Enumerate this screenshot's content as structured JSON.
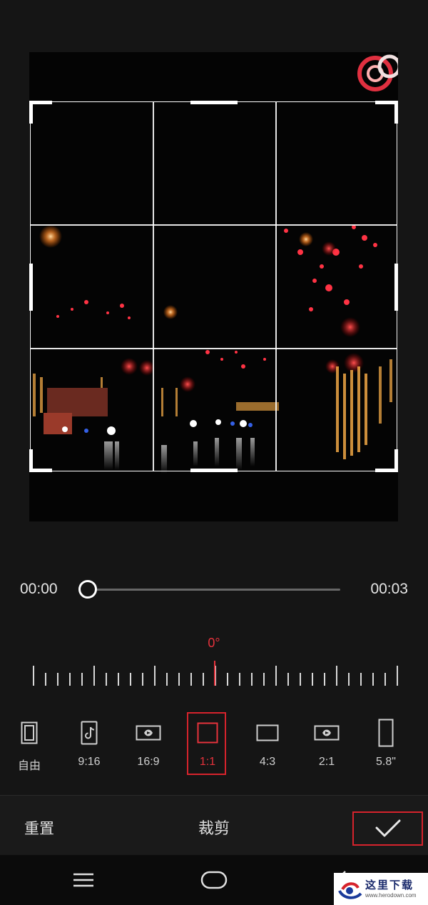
{
  "timeline": {
    "start_time": "00:00",
    "end_time": "00:03",
    "progress": 0
  },
  "rotation": {
    "angle_label": "0°"
  },
  "ratios": [
    {
      "label": "自由",
      "icon": "free-crop-icon"
    },
    {
      "label": "9:16",
      "icon": "tiktok-9-16-icon"
    },
    {
      "label": "16:9",
      "icon": "video-16-9-icon"
    },
    {
      "label": "1:1",
      "icon": "square-1-1-icon",
      "selected": true
    },
    {
      "label": "4:3",
      "icon": "rect-4-3-icon"
    },
    {
      "label": "2:1",
      "icon": "video-2-1-icon"
    },
    {
      "label": "5.8\"",
      "icon": "phone-5-8-icon"
    }
  ],
  "action_bar": {
    "reset_label": "重置",
    "title": "裁剪",
    "confirm_icon": "check-icon"
  },
  "nav": {
    "menu_icon": "menu-icon",
    "home_icon": "home-icon",
    "back_icon": "back-icon"
  },
  "watermark": {
    "text": "这里下载",
    "sub": "www.herodown.com"
  },
  "colors": {
    "accent": "#e6323c",
    "highlight_box": "#d6232c",
    "background": "#151515"
  }
}
